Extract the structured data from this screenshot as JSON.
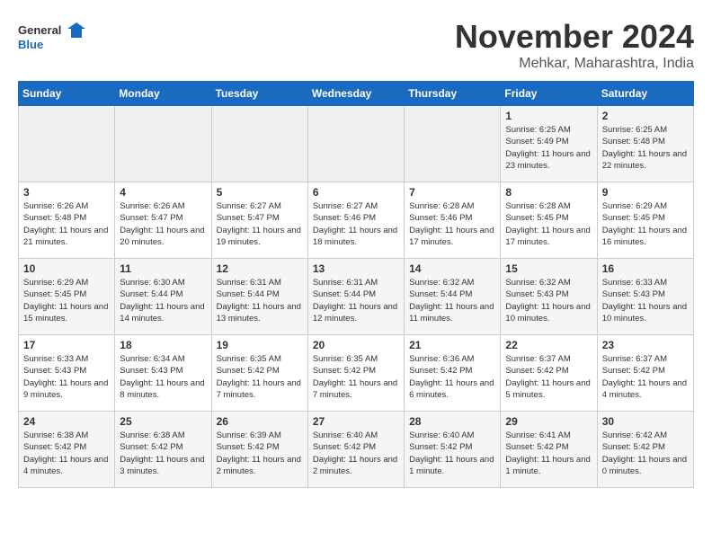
{
  "logo": {
    "text_general": "General",
    "text_blue": "Blue"
  },
  "header": {
    "month_year": "November 2024",
    "location": "Mehkar, Maharashtra, India"
  },
  "weekdays": [
    "Sunday",
    "Monday",
    "Tuesday",
    "Wednesday",
    "Thursday",
    "Friday",
    "Saturday"
  ],
  "weeks": [
    [
      {
        "day": "",
        "info": ""
      },
      {
        "day": "",
        "info": ""
      },
      {
        "day": "",
        "info": ""
      },
      {
        "day": "",
        "info": ""
      },
      {
        "day": "",
        "info": ""
      },
      {
        "day": "1",
        "info": "Sunrise: 6:25 AM\nSunset: 5:49 PM\nDaylight: 11 hours and 23 minutes."
      },
      {
        "day": "2",
        "info": "Sunrise: 6:25 AM\nSunset: 5:48 PM\nDaylight: 11 hours and 22 minutes."
      }
    ],
    [
      {
        "day": "3",
        "info": "Sunrise: 6:26 AM\nSunset: 5:48 PM\nDaylight: 11 hours and 21 minutes."
      },
      {
        "day": "4",
        "info": "Sunrise: 6:26 AM\nSunset: 5:47 PM\nDaylight: 11 hours and 20 minutes."
      },
      {
        "day": "5",
        "info": "Sunrise: 6:27 AM\nSunset: 5:47 PM\nDaylight: 11 hours and 19 minutes."
      },
      {
        "day": "6",
        "info": "Sunrise: 6:27 AM\nSunset: 5:46 PM\nDaylight: 11 hours and 18 minutes."
      },
      {
        "day": "7",
        "info": "Sunrise: 6:28 AM\nSunset: 5:46 PM\nDaylight: 11 hours and 17 minutes."
      },
      {
        "day": "8",
        "info": "Sunrise: 6:28 AM\nSunset: 5:45 PM\nDaylight: 11 hours and 17 minutes."
      },
      {
        "day": "9",
        "info": "Sunrise: 6:29 AM\nSunset: 5:45 PM\nDaylight: 11 hours and 16 minutes."
      }
    ],
    [
      {
        "day": "10",
        "info": "Sunrise: 6:29 AM\nSunset: 5:45 PM\nDaylight: 11 hours and 15 minutes."
      },
      {
        "day": "11",
        "info": "Sunrise: 6:30 AM\nSunset: 5:44 PM\nDaylight: 11 hours and 14 minutes."
      },
      {
        "day": "12",
        "info": "Sunrise: 6:31 AM\nSunset: 5:44 PM\nDaylight: 11 hours and 13 minutes."
      },
      {
        "day": "13",
        "info": "Sunrise: 6:31 AM\nSunset: 5:44 PM\nDaylight: 11 hours and 12 minutes."
      },
      {
        "day": "14",
        "info": "Sunrise: 6:32 AM\nSunset: 5:44 PM\nDaylight: 11 hours and 11 minutes."
      },
      {
        "day": "15",
        "info": "Sunrise: 6:32 AM\nSunset: 5:43 PM\nDaylight: 11 hours and 10 minutes."
      },
      {
        "day": "16",
        "info": "Sunrise: 6:33 AM\nSunset: 5:43 PM\nDaylight: 11 hours and 10 minutes."
      }
    ],
    [
      {
        "day": "17",
        "info": "Sunrise: 6:33 AM\nSunset: 5:43 PM\nDaylight: 11 hours and 9 minutes."
      },
      {
        "day": "18",
        "info": "Sunrise: 6:34 AM\nSunset: 5:43 PM\nDaylight: 11 hours and 8 minutes."
      },
      {
        "day": "19",
        "info": "Sunrise: 6:35 AM\nSunset: 5:42 PM\nDaylight: 11 hours and 7 minutes."
      },
      {
        "day": "20",
        "info": "Sunrise: 6:35 AM\nSunset: 5:42 PM\nDaylight: 11 hours and 7 minutes."
      },
      {
        "day": "21",
        "info": "Sunrise: 6:36 AM\nSunset: 5:42 PM\nDaylight: 11 hours and 6 minutes."
      },
      {
        "day": "22",
        "info": "Sunrise: 6:37 AM\nSunset: 5:42 PM\nDaylight: 11 hours and 5 minutes."
      },
      {
        "day": "23",
        "info": "Sunrise: 6:37 AM\nSunset: 5:42 PM\nDaylight: 11 hours and 4 minutes."
      }
    ],
    [
      {
        "day": "24",
        "info": "Sunrise: 6:38 AM\nSunset: 5:42 PM\nDaylight: 11 hours and 4 minutes."
      },
      {
        "day": "25",
        "info": "Sunrise: 6:38 AM\nSunset: 5:42 PM\nDaylight: 11 hours and 3 minutes."
      },
      {
        "day": "26",
        "info": "Sunrise: 6:39 AM\nSunset: 5:42 PM\nDaylight: 11 hours and 2 minutes."
      },
      {
        "day": "27",
        "info": "Sunrise: 6:40 AM\nSunset: 5:42 PM\nDaylight: 11 hours and 2 minutes."
      },
      {
        "day": "28",
        "info": "Sunrise: 6:40 AM\nSunset: 5:42 PM\nDaylight: 11 hours and 1 minute."
      },
      {
        "day": "29",
        "info": "Sunrise: 6:41 AM\nSunset: 5:42 PM\nDaylight: 11 hours and 1 minute."
      },
      {
        "day": "30",
        "info": "Sunrise: 6:42 AM\nSunset: 5:42 PM\nDaylight: 11 hours and 0 minutes."
      }
    ]
  ]
}
